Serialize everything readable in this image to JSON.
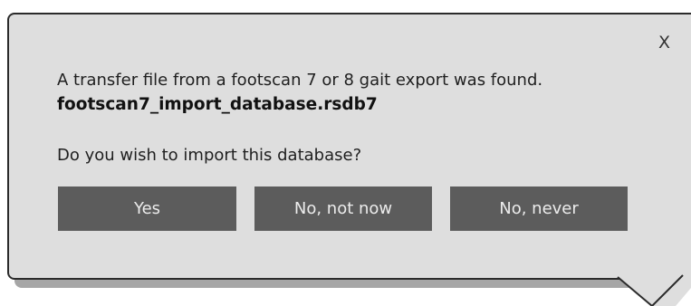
{
  "dialog": {
    "close_label": "X",
    "message_line": "A transfer file from a footscan 7 or 8 gait export was found.",
    "file_name": "footscan7_import_database.rsdb7",
    "question": "Do you wish to import this database?",
    "buttons": {
      "yes": "Yes",
      "not_now": "No, not now",
      "never": "No, never"
    }
  },
  "colors": {
    "dialog_background": "#dedede",
    "dialog_border": "#2b2b2b",
    "shadow": "#a6a6a6",
    "button_background": "#5c5c5c",
    "button_text": "#ececec"
  },
  "icons": {
    "close": "close-icon"
  }
}
